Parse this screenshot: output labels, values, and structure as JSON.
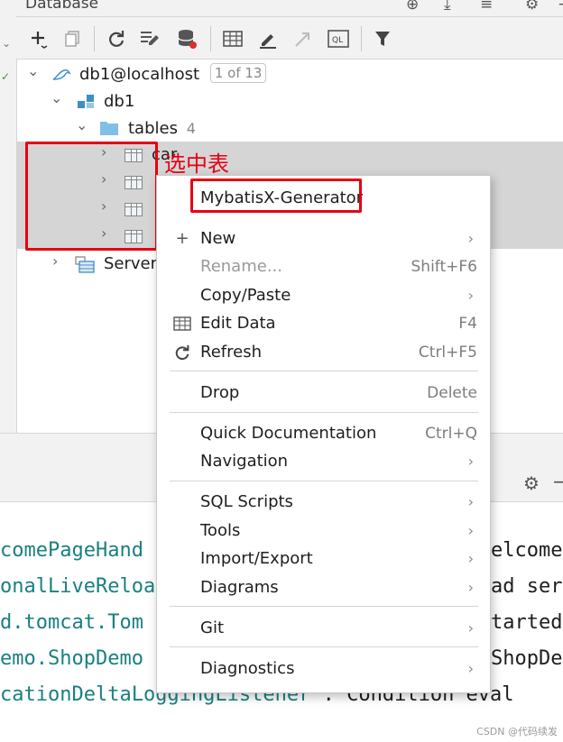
{
  "panel": {
    "title": "Database"
  },
  "tree": {
    "connection": {
      "label": "db1@localhost",
      "badge": "1 of 13"
    },
    "database": {
      "label": "db1"
    },
    "tables_folder": {
      "label": "tables",
      "count": "4"
    },
    "tables": [
      {
        "label": "car"
      },
      {
        "label": ""
      },
      {
        "label": ""
      },
      {
        "label": ""
      }
    ],
    "server_objects": {
      "label": "Server"
    }
  },
  "annotation": {
    "text": "选中表"
  },
  "context_menu": {
    "items": [
      {
        "label": "MybatisX-Generator",
        "shortcut": "",
        "submenu": false
      },
      {
        "label": "New",
        "shortcut": "",
        "submenu": true
      },
      {
        "label": "Rename...",
        "shortcut": "Shift+F6",
        "submenu": false,
        "disabled": true
      },
      {
        "label": "Copy/Paste",
        "shortcut": "",
        "submenu": true
      },
      {
        "label": "Edit Data",
        "shortcut": "F4",
        "submenu": false
      },
      {
        "label": "Refresh",
        "shortcut": "Ctrl+F5",
        "submenu": false
      },
      {
        "label": "Drop",
        "shortcut": "Delete",
        "submenu": false
      },
      {
        "label": "Quick Documentation",
        "shortcut": "Ctrl+Q",
        "submenu": false
      },
      {
        "label": "Navigation",
        "shortcut": "",
        "submenu": true
      },
      {
        "label": "SQL Scripts",
        "shortcut": "",
        "submenu": true
      },
      {
        "label": "Tools",
        "shortcut": "",
        "submenu": true
      },
      {
        "label": "Import/Export",
        "shortcut": "",
        "submenu": true
      },
      {
        "label": "Diagrams",
        "shortcut": "",
        "submenu": true
      },
      {
        "label": "Git",
        "shortcut": "",
        "submenu": true
      },
      {
        "label": "Diagnostics",
        "shortcut": "",
        "submenu": true
      }
    ]
  },
  "console": {
    "lines": [
      {
        "left": "comePageHand",
        "right": "elcome"
      },
      {
        "left": "onalLiveReloa",
        "right": "ad ser"
      },
      {
        "left": "d.tomcat.Tom",
        "right": "tarted"
      },
      {
        "left": "emo.ShopDemo",
        "right": "ShopDe"
      },
      {
        "left": "cationDeltaLoggingListener",
        "right": " : Condition eval"
      }
    ]
  },
  "watermark": "CSDN @代码续发",
  "colors": {
    "highlight_red": "#e60012",
    "console_teal": "#1a8080",
    "selection_gray": "#d5d5d5"
  }
}
